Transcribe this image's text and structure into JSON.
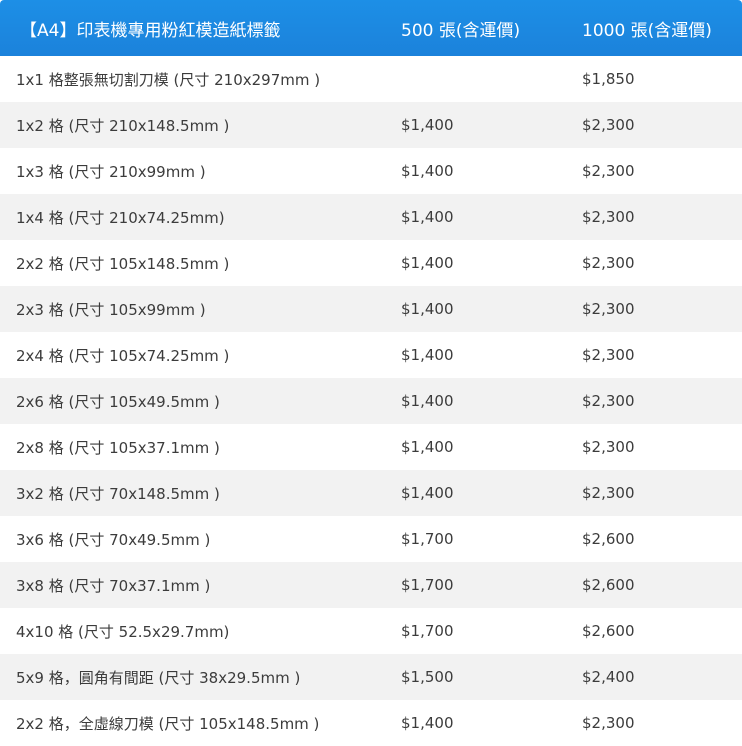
{
  "header": {
    "product": "【A4】印表機專用粉紅模造紙標籤",
    "col_500": "500 張(含運價)",
    "col_1000": "1000  張(含運價)"
  },
  "rows": [
    {
      "item": "1x1  格整張無切割刀模 (尺寸 210x297mm )",
      "price_500": "",
      "price_1000": "$1,850"
    },
    {
      "item": "1x2  格 (尺寸 210x148.5mm )",
      "price_500": "$1,400",
      "price_1000": "$2,300"
    },
    {
      "item": "1x3  格 (尺寸 210x99mm )",
      "price_500": "$1,400",
      "price_1000": "$2,300"
    },
    {
      "item": "1x4  格 (尺寸 210x74.25mm)",
      "price_500": "$1,400",
      "price_1000": "$2,300"
    },
    {
      "item": "2x2 格 (尺寸 105x148.5mm )",
      "price_500": "$1,400",
      "price_1000": "$2,300"
    },
    {
      "item": "2x3 格 (尺寸 105x99mm )",
      "price_500": "$1,400",
      "price_1000": "$2,300"
    },
    {
      "item": "2x4 格 (尺寸 105x74.25mm )",
      "price_500": "$1,400",
      "price_1000": "$2,300"
    },
    {
      "item": "2x6 格 (尺寸 105x49.5mm )",
      "price_500": "$1,400",
      "price_1000": "$2,300"
    },
    {
      "item": "2x8 格 (尺寸 105x37.1mm )",
      "price_500": "$1,400",
      "price_1000": "$2,300"
    },
    {
      "item": "3x2 格 (尺寸 70x148.5mm )",
      "price_500": "$1,400",
      "price_1000": "$2,300"
    },
    {
      "item": "3x6 格 (尺寸 70x49.5mm )",
      "price_500": "$1,700",
      "price_1000": "$2,600"
    },
    {
      "item": "3x8 格 (尺寸 70x37.1mm )",
      "price_500": "$1,700",
      "price_1000": "$2,600"
    },
    {
      "item": "4x10  格 (尺寸 52.5x29.7mm)",
      "price_500": "$1,700",
      "price_1000": "$2,600"
    },
    {
      "item": "5x9 格，圓角有間距 (尺寸 38x29.5mm )",
      "price_500": "$1,500",
      "price_1000": "$2,400"
    },
    {
      "item": "2x2 格，全虛線刀模 (尺寸 105x148.5mm )",
      "price_500": "$1,400",
      "price_1000": "$2,300"
    }
  ]
}
